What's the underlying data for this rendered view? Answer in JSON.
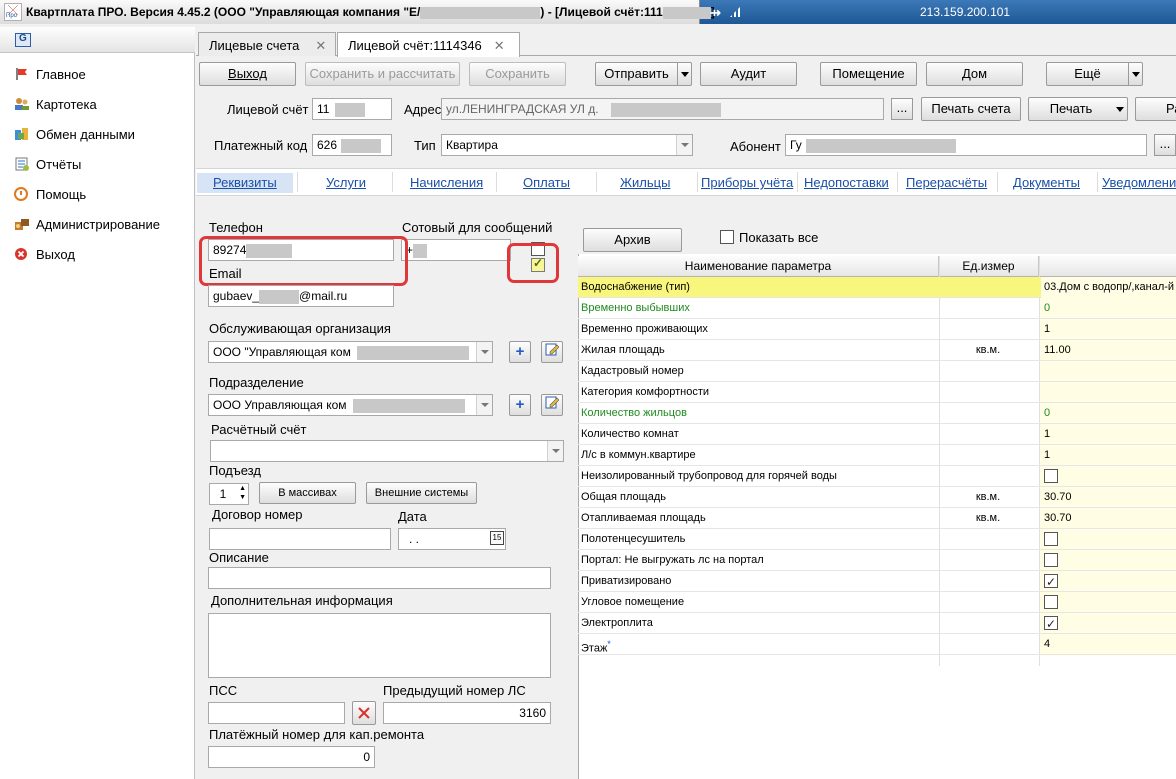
{
  "window": {
    "title_prefix": "Квартплата ПРО.  Версия 4.45.2 (ООО \"Управляющая компания \"Е/",
    "title_suffix": ") - [Лицевой счёт:111",
    "title_end": "]",
    "ip": "213.159.200.101"
  },
  "nav": {
    "items": [
      {
        "label": "Главное",
        "icon": "flag-icon"
      },
      {
        "label": "Картотека",
        "icon": "people-icon"
      },
      {
        "label": "Обмен данными",
        "icon": "exchange-icon"
      },
      {
        "label": "Отчёты",
        "icon": "reports-icon"
      },
      {
        "label": "Помощь",
        "icon": "help-icon"
      },
      {
        "label": "Администрирование",
        "icon": "admin-icon"
      },
      {
        "label": "Выход",
        "icon": "exit-icon"
      }
    ]
  },
  "tabs": [
    {
      "label": "Лицевые счета",
      "close": "✕"
    },
    {
      "label": "Лицевой счёт:1114346",
      "close": "✕"
    }
  ],
  "toolbar": {
    "exit": "Выход",
    "save_calc": "Сохранить и рассчитать",
    "save": "Сохранить",
    "send": "Отправить",
    "audit": "Аудит",
    "room": "Помещение",
    "house": "Дом",
    "more": "Ещё"
  },
  "account": {
    "account_label": "Лицевой счёт",
    "account_value": "11",
    "address_label": "Адрес",
    "address_value": "ул.ЛЕНИНГРАДСКАЯ УЛ д.",
    "print_account": "Печать счета",
    "print": "Печать",
    "print_cut": "Ра",
    "dots": "...",
    "pay_code_label": "Платежный код",
    "pay_code_value": "626",
    "type_label": "Тип",
    "type_value": "Квартира",
    "subscriber_label": "Абонент",
    "subscriber_value": "Гу"
  },
  "sections": [
    "Реквизиты",
    "Услуги",
    "Начисления",
    "Оплаты",
    "Жильцы",
    "Приборы учёта",
    "Недопоставки",
    "Перерасчёты",
    "Документы",
    "Уведомления"
  ],
  "form": {
    "phone_label": "Телефон",
    "phone_value": "89274",
    "mobile_label": "Сотовый для сообщений",
    "mobile_value": "+",
    "email_label": "Email",
    "email_prefix": "gubaev_",
    "email_suffix": "@mail.ru",
    "org_label": "Обслуживающая организация",
    "org_value": "ООО \"Управляющая ком",
    "division_label": "Подразделение",
    "division_value": "ООО Управляющая ком",
    "calc_account_label": "Расчётный счёт",
    "calc_account_value": "",
    "entrance_label": "Подъезд",
    "entrance_value": "1",
    "in_arrays_btn": "В массивах",
    "external_btn": "Внешние системы",
    "contract_label": "Договор номер",
    "contract_value": "",
    "date_label": "Дата",
    "date_value": " .  .",
    "calendar": "15",
    "description_label": "Описание",
    "description_value": "",
    "extra_label": "Дополнительная информация",
    "extra_value": "",
    "pss_label": "ПСС",
    "pss_value": "",
    "prev_account_label": "Предыдущий номер ЛС",
    "prev_account_value": "3160",
    "capital_label": "Платёжный номер для кап.ремонта",
    "capital_value": "0"
  },
  "params": {
    "archive_btn": "Архив",
    "show_all_label": "Показать все",
    "col_name": "Наименование параметра",
    "col_unit": "Ед.измер",
    "rows": [
      {
        "name": "Водоснабжение (тип)",
        "unit": "",
        "value": "03.Дом с водопр/,канал-й",
        "green": false,
        "selected": true
      },
      {
        "name": "Временно выбывших",
        "unit": "",
        "value": "0",
        "green": true
      },
      {
        "name": "Временно проживающих",
        "unit": "",
        "value": "1",
        "green": false
      },
      {
        "name": "Жилая площадь",
        "unit": "кв.м.",
        "value": "11.00",
        "green": false
      },
      {
        "name": "Кадастровый номер",
        "unit": "",
        "value": "",
        "green": false
      },
      {
        "name": "Категория комфортности",
        "unit": "",
        "value": "",
        "green": false
      },
      {
        "name": "Количество жильцов",
        "unit": "",
        "value": "0",
        "green": true
      },
      {
        "name": "Количество комнат",
        "unit": "",
        "value": "1",
        "green": false
      },
      {
        "name": "Л/с в коммун.квартире",
        "unit": "",
        "value": "1",
        "green": false
      },
      {
        "name": "Неизолированный трубопровод для горячей воды",
        "unit": "",
        "check": false,
        "green": false
      },
      {
        "name": "Общая площадь",
        "unit": "кв.м.",
        "value": "30.70",
        "green": false
      },
      {
        "name": "Отапливаемая площадь",
        "unit": "кв.м.",
        "value": "30.70",
        "green": false
      },
      {
        "name": "Полотенцесушитель",
        "unit": "",
        "check": false,
        "green": false
      },
      {
        "name": "Портал: Не выгружать лс на портал",
        "unit": "",
        "check": false,
        "green": false
      },
      {
        "name": "Приватизировано",
        "unit": "",
        "check": true,
        "green": false
      },
      {
        "name": "Угловое помещение",
        "unit": "",
        "check": false,
        "green": false
      },
      {
        "name": "Электроплита",
        "unit": "",
        "check": true,
        "green": false
      },
      {
        "name": "Этаж",
        "unit": "",
        "value": "4",
        "green": false,
        "star": "*"
      }
    ]
  }
}
